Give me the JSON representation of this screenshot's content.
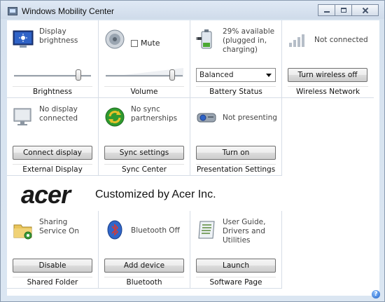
{
  "window": {
    "title": "Windows Mobility Center"
  },
  "tiles": [
    {
      "status": "Display brightness",
      "label": "Brightness",
      "control": "slider",
      "level": 0.85
    },
    {
      "checkbox_label": "Mute",
      "label": "Volume",
      "control": "slider",
      "level": 0.88
    },
    {
      "status": "29% available (plugged in, charging)",
      "label": "Battery Status",
      "control": "select",
      "selected": "Balanced"
    },
    {
      "status": "Not connected",
      "label": "Wireless Network",
      "control": "button",
      "button": "Turn wireless off"
    },
    {
      "status": "No display connected",
      "label": "External Display",
      "control": "button",
      "button": "Connect display"
    },
    {
      "status": "No sync partnerships",
      "label": "Sync Center",
      "control": "button",
      "button": "Sync settings"
    },
    {
      "status": "Not presenting",
      "label": "Presentation Settings",
      "control": "button",
      "button": "Turn on"
    },
    {
      "status": "Sharing Service On",
      "label": "Shared Folder",
      "control": "button",
      "button": "Disable"
    },
    {
      "status": "Bluetooth Off",
      "label": "Bluetooth",
      "control": "button",
      "button": "Add device"
    },
    {
      "status": "User Guide, Drivers and Utilities",
      "label": "Software Page",
      "control": "button",
      "button": "Launch"
    }
  ],
  "banner": {
    "logo": "acer",
    "text": "Customized by Acer Inc."
  },
  "icons": {
    "help": "help-icon",
    "help_glyph": "?"
  },
  "colors": {
    "accent": "#1c5fc7"
  }
}
